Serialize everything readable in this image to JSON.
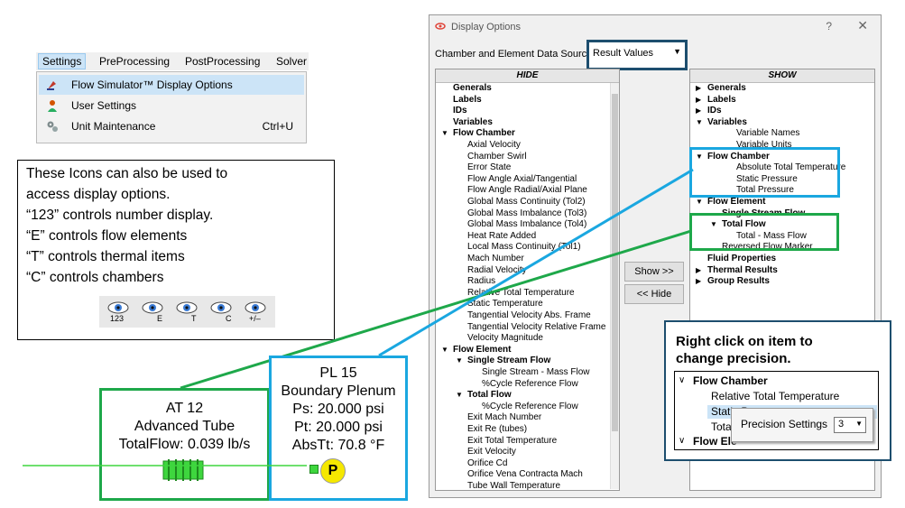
{
  "menu": {
    "items": [
      "Settings",
      "PreProcessing",
      "PostProcessing",
      "Solver"
    ],
    "dropdown": [
      {
        "label": "Flow Simulator™ Display Options",
        "shortcut": ""
      },
      {
        "label": "User Settings",
        "shortcut": ""
      },
      {
        "label": "Unit Maintenance",
        "shortcut": "Ctrl+U"
      }
    ]
  },
  "info": {
    "lines": [
      "These Icons can also be used to",
      "access display options.",
      "“123” controls number display.",
      "“E” controls flow elements",
      "“T” controls thermal items",
      "“C” controls chambers"
    ],
    "icon_labels": [
      "123",
      "E",
      "T",
      "C",
      "+/–"
    ]
  },
  "at_box": {
    "line1": "AT  12",
    "line2": "Advanced Tube",
    "line3": "TotalFlow: 0.039 lb/s"
  },
  "pl_box": {
    "line1": "PL 15",
    "line2": "Boundary Plenum",
    "line3": "Ps: 20.000 psi",
    "line4": "Pt: 20.000 psi",
    "line5": "AbsTt: 70.8 °F",
    "marker": "P"
  },
  "dialog": {
    "title": "Display Options",
    "help": "?",
    "close": "✕",
    "source_label": "Chamber and Element Data Source:",
    "source_value": "Result Values",
    "hide_header": "HIDE",
    "show_header": "SHOW",
    "show_button": "Show >>",
    "hide_button": "<< Hide",
    "hide_items": [
      {
        "text": "Generals",
        "bold": true,
        "indent": 0,
        "twisty": ""
      },
      {
        "text": "Labels",
        "bold": true,
        "indent": 0,
        "twisty": ""
      },
      {
        "text": "IDs",
        "bold": true,
        "indent": 0,
        "twisty": ""
      },
      {
        "text": "Variables",
        "bold": true,
        "indent": 0,
        "twisty": ""
      },
      {
        "text": "Flow Chamber",
        "bold": true,
        "indent": 0,
        "twisty": "open"
      },
      {
        "text": "Axial Velocity",
        "bold": false,
        "indent": 1,
        "twisty": ""
      },
      {
        "text": "Chamber Swirl",
        "bold": false,
        "indent": 1,
        "twisty": ""
      },
      {
        "text": "Error State",
        "bold": false,
        "indent": 1,
        "twisty": ""
      },
      {
        "text": "Flow Angle Axial/Tangential",
        "bold": false,
        "indent": 1,
        "twisty": ""
      },
      {
        "text": "Flow Angle Radial/Axial Plane",
        "bold": false,
        "indent": 1,
        "twisty": ""
      },
      {
        "text": "Global Mass Continuity (Tol2)",
        "bold": false,
        "indent": 1,
        "twisty": ""
      },
      {
        "text": "Global Mass Imbalance (Tol3)",
        "bold": false,
        "indent": 1,
        "twisty": ""
      },
      {
        "text": "Global Mass Imbalance (Tol4)",
        "bold": false,
        "indent": 1,
        "twisty": ""
      },
      {
        "text": "Heat Rate Added",
        "bold": false,
        "indent": 1,
        "twisty": ""
      },
      {
        "text": "Local Mass Continuity (Tol1)",
        "bold": false,
        "indent": 1,
        "twisty": ""
      },
      {
        "text": "Mach Number",
        "bold": false,
        "indent": 1,
        "twisty": ""
      },
      {
        "text": "Radial Velocity",
        "bold": false,
        "indent": 1,
        "twisty": ""
      },
      {
        "text": "Radius",
        "bold": false,
        "indent": 1,
        "twisty": ""
      },
      {
        "text": "Relative Total Temperature",
        "bold": false,
        "indent": 1,
        "twisty": ""
      },
      {
        "text": "Static Temperature",
        "bold": false,
        "indent": 1,
        "twisty": ""
      },
      {
        "text": "Tangential Velocity Abs. Frame",
        "bold": false,
        "indent": 1,
        "twisty": ""
      },
      {
        "text": "Tangential Velocity Relative Frame",
        "bold": false,
        "indent": 1,
        "twisty": ""
      },
      {
        "text": "Velocity Magnitude",
        "bold": false,
        "indent": 1,
        "twisty": ""
      },
      {
        "text": "Flow Element",
        "bold": true,
        "indent": 0,
        "twisty": "open"
      },
      {
        "text": "Single Stream Flow",
        "bold": true,
        "indent": 1,
        "twisty": "open"
      },
      {
        "text": "Single Stream - Mass Flow",
        "bold": false,
        "indent": 2,
        "twisty": ""
      },
      {
        "text": "%Cycle Reference Flow",
        "bold": false,
        "indent": 2,
        "twisty": ""
      },
      {
        "text": "Total Flow",
        "bold": true,
        "indent": 1,
        "twisty": "open"
      },
      {
        "text": "%Cycle Reference Flow",
        "bold": false,
        "indent": 2,
        "twisty": ""
      },
      {
        "text": "Exit Mach Number",
        "bold": false,
        "indent": 1,
        "twisty": ""
      },
      {
        "text": "Exit Re (tubes)",
        "bold": false,
        "indent": 1,
        "twisty": ""
      },
      {
        "text": "Exit Total Temperature",
        "bold": false,
        "indent": 1,
        "twisty": ""
      },
      {
        "text": "Exit Velocity",
        "bold": false,
        "indent": 1,
        "twisty": ""
      },
      {
        "text": "Orifice Cd",
        "bold": false,
        "indent": 1,
        "twisty": ""
      },
      {
        "text": "Orifice Vena Contracta Mach",
        "bold": false,
        "indent": 1,
        "twisty": ""
      },
      {
        "text": "Tube Wall Temperature",
        "bold": false,
        "indent": 1,
        "twisty": ""
      }
    ],
    "show_items": [
      {
        "text": "Generals",
        "bold": true,
        "indent": 0,
        "twisty": "closed"
      },
      {
        "text": "Labels",
        "bold": true,
        "indent": 0,
        "twisty": "closed"
      },
      {
        "text": "IDs",
        "bold": true,
        "indent": 0,
        "twisty": "closed"
      },
      {
        "text": "Variables",
        "bold": true,
        "indent": 0,
        "twisty": "open"
      },
      {
        "text": "Variable Names",
        "bold": false,
        "indent": 2,
        "twisty": ""
      },
      {
        "text": "Variable Units",
        "bold": false,
        "indent": 2,
        "twisty": ""
      },
      {
        "text": "Flow Chamber",
        "bold": true,
        "indent": 0,
        "twisty": "open"
      },
      {
        "text": "Absolute Total Temperature",
        "bold": false,
        "indent": 2,
        "twisty": ""
      },
      {
        "text": "Static Pressure",
        "bold": false,
        "indent": 2,
        "twisty": ""
      },
      {
        "text": "Total Pressure",
        "bold": false,
        "indent": 2,
        "twisty": ""
      },
      {
        "text": "Flow Element",
        "bold": true,
        "indent": 0,
        "twisty": "open"
      },
      {
        "text": "Single Stream Flow",
        "bold": true,
        "indent": 1,
        "twisty": ""
      },
      {
        "text": "Total Flow",
        "bold": true,
        "indent": 1,
        "twisty": "open"
      },
      {
        "text": "Total - Mass Flow",
        "bold": false,
        "indent": 2,
        "twisty": ""
      },
      {
        "text": "Reversed Flow Marker",
        "bold": false,
        "indent": 1,
        "twisty": ""
      },
      {
        "text": "Fluid Properties",
        "bold": true,
        "indent": 0,
        "twisty": ""
      },
      {
        "text": "Thermal Results",
        "bold": true,
        "indent": 0,
        "twisty": "closed"
      },
      {
        "text": "Group Results",
        "bold": true,
        "indent": 0,
        "twisty": "closed"
      }
    ]
  },
  "tip": {
    "text_line1": "Right click on item to",
    "text_line2": "change precision.",
    "tree": [
      "Flow Chamber",
      "Relative Total Temperature",
      "Static P",
      "Tota",
      "Flow Ele"
    ],
    "context_label": "Precision Settings",
    "context_value": "3"
  },
  "colors": {
    "green": "#1ea84a",
    "blue": "#1aa7e0",
    "navy": "#1d4e6e",
    "tube": "#3ed63e",
    "plenum": "#f5e800"
  }
}
